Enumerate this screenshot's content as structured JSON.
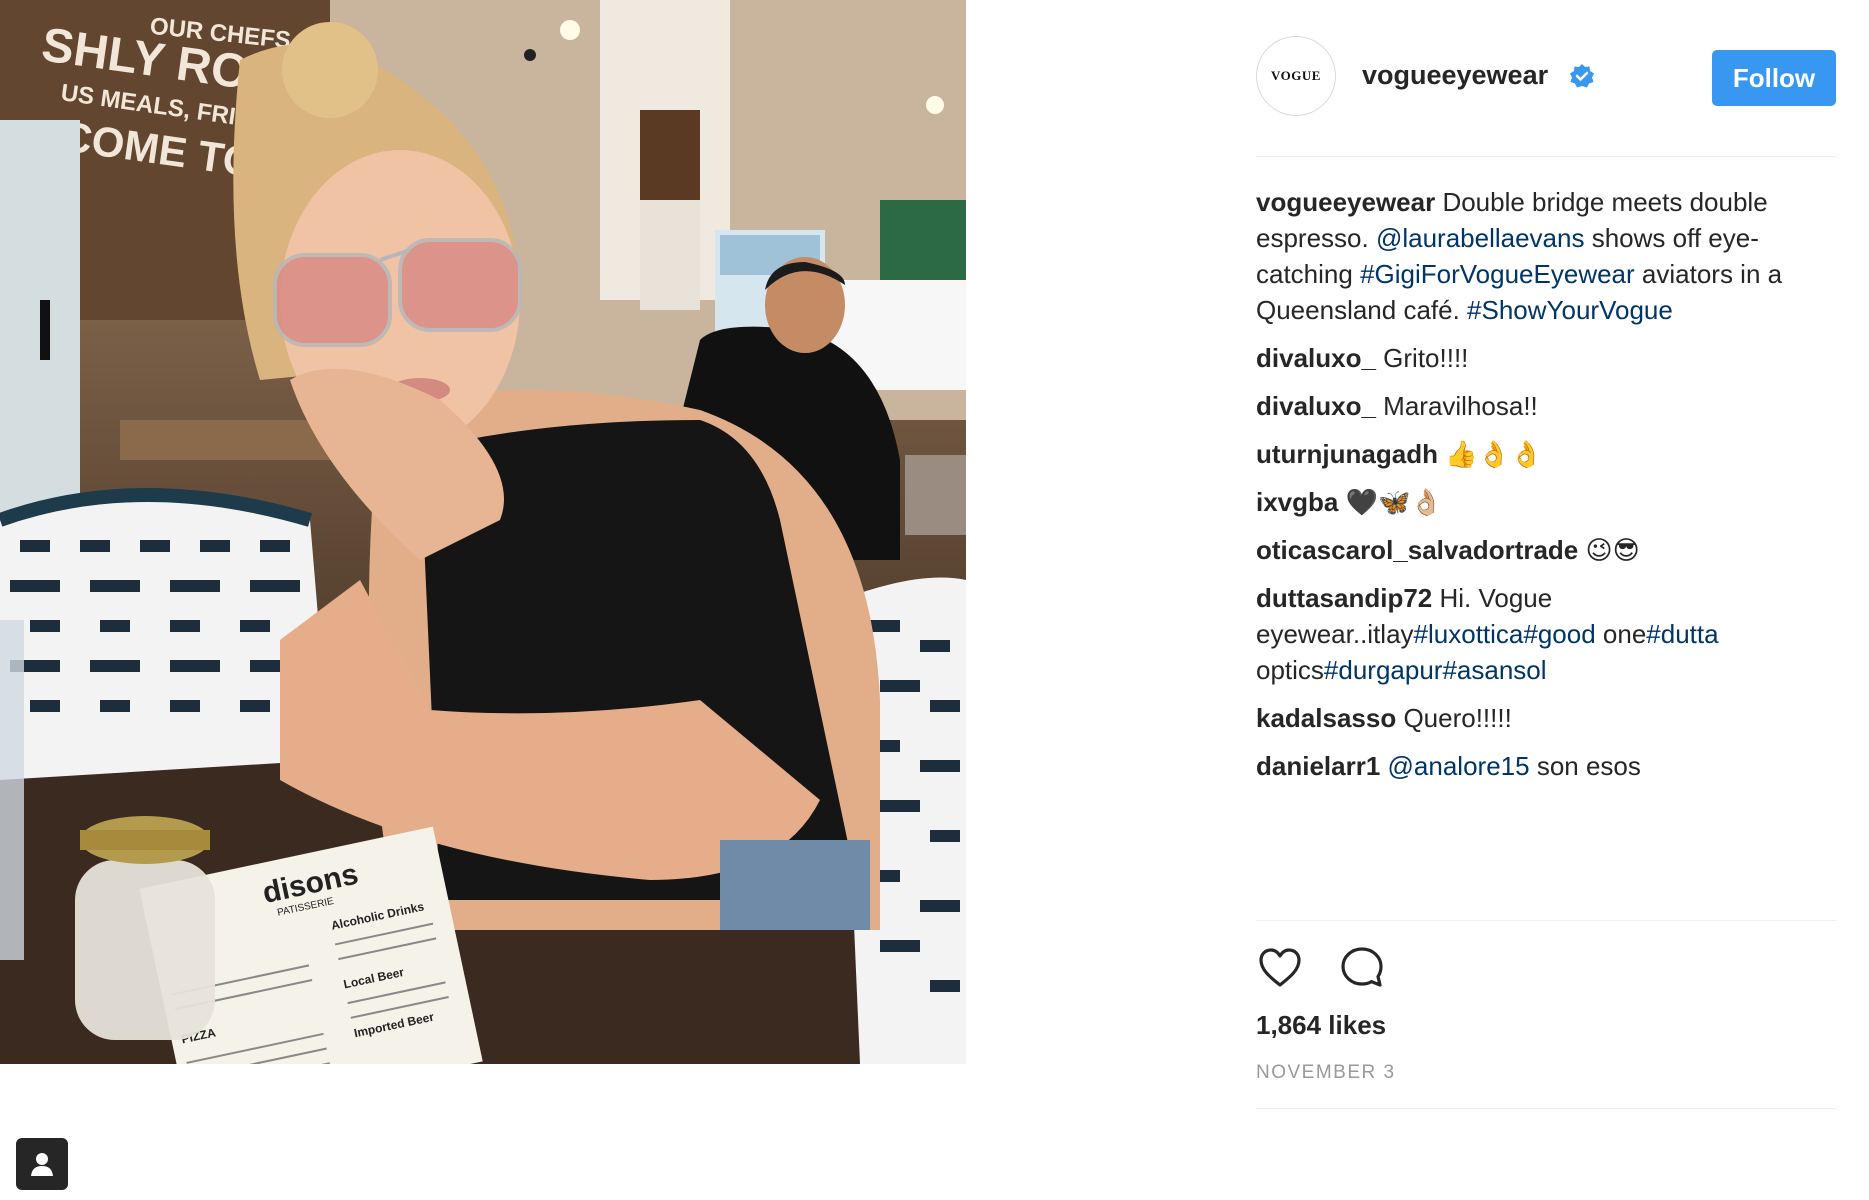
{
  "post": {
    "account": {
      "username": "vogueeyewear",
      "avatar_text": "VOGUE",
      "verified": true,
      "follow_label": "Follow"
    },
    "caption": {
      "username": "vogueeyewear",
      "parts": [
        {
          "type": "text",
          "value": " Double bridge meets double espresso. "
        },
        {
          "type": "link",
          "value": "@laurabellaevans"
        },
        {
          "type": "text",
          "value": " shows off eye-catching "
        },
        {
          "type": "link",
          "value": "#GigiForVogueEyewear"
        },
        {
          "type": "text",
          "value": " aviators in a Queensland café. "
        },
        {
          "type": "link",
          "value": "#ShowYourVogue"
        }
      ]
    },
    "comments": [
      {
        "username": "divaluxo_",
        "parts": [
          {
            "type": "text",
            "value": " Grito!!!!"
          }
        ]
      },
      {
        "username": "divaluxo_",
        "parts": [
          {
            "type": "text",
            "value": " Maravilhosa!!"
          }
        ]
      },
      {
        "username": "uturnjunagadh",
        "parts": [
          {
            "type": "text",
            "value": " 👍👌👌"
          }
        ]
      },
      {
        "username": "ixvgba",
        "parts": [
          {
            "type": "text",
            "value": " 🖤🦋👌🏼"
          }
        ]
      },
      {
        "username": "oticascarol_salvadortrade",
        "parts": [
          {
            "type": "text",
            "value": " 😉😎"
          }
        ]
      },
      {
        "username": "duttasandip72",
        "parts": [
          {
            "type": "text",
            "value": " Hi. Vogue eyewear..itlay"
          },
          {
            "type": "link",
            "value": "#luxottica"
          },
          {
            "type": "link",
            "value": "#good"
          },
          {
            "type": "text",
            "value": " one"
          },
          {
            "type": "link",
            "value": "#dutta"
          },
          {
            "type": "text",
            "value": " optics"
          },
          {
            "type": "link",
            "value": "#durgapur"
          },
          {
            "type": "link",
            "value": "#asansol"
          }
        ]
      },
      {
        "username": "kadalsasso",
        "parts": [
          {
            "type": "text",
            "value": " Quero!!!!!"
          }
        ]
      },
      {
        "username": "danielarr1",
        "parts": [
          {
            "type": "text",
            "value": " "
          },
          {
            "type": "link",
            "value": "@analore15"
          },
          {
            "type": "text",
            "value": " son esos"
          }
        ]
      }
    ],
    "actions": {
      "like_icon": "heart-outline-icon",
      "comment_icon": "speech-bubble-icon"
    },
    "likes": "1,864 likes",
    "date": "NOVEMBER 3",
    "photo_menu_texts": [
      "disons",
      "PATISSERIE",
      "Alcoholic Drinks",
      "Local Beer",
      "Imported Beer",
      "PIZZA"
    ],
    "photo_wall_texts": [
      "SHLY ROAST",
      "US MEALS, FRIENDLY ST",
      "COME TO MA",
      "OUR CHEFS AT"
    ]
  },
  "colors": {
    "follow_button": "#3897f0",
    "link": "#003569",
    "verified_badge": "#3897f0",
    "text": "#262626",
    "muted": "#999999",
    "divider": "#efefef"
  }
}
